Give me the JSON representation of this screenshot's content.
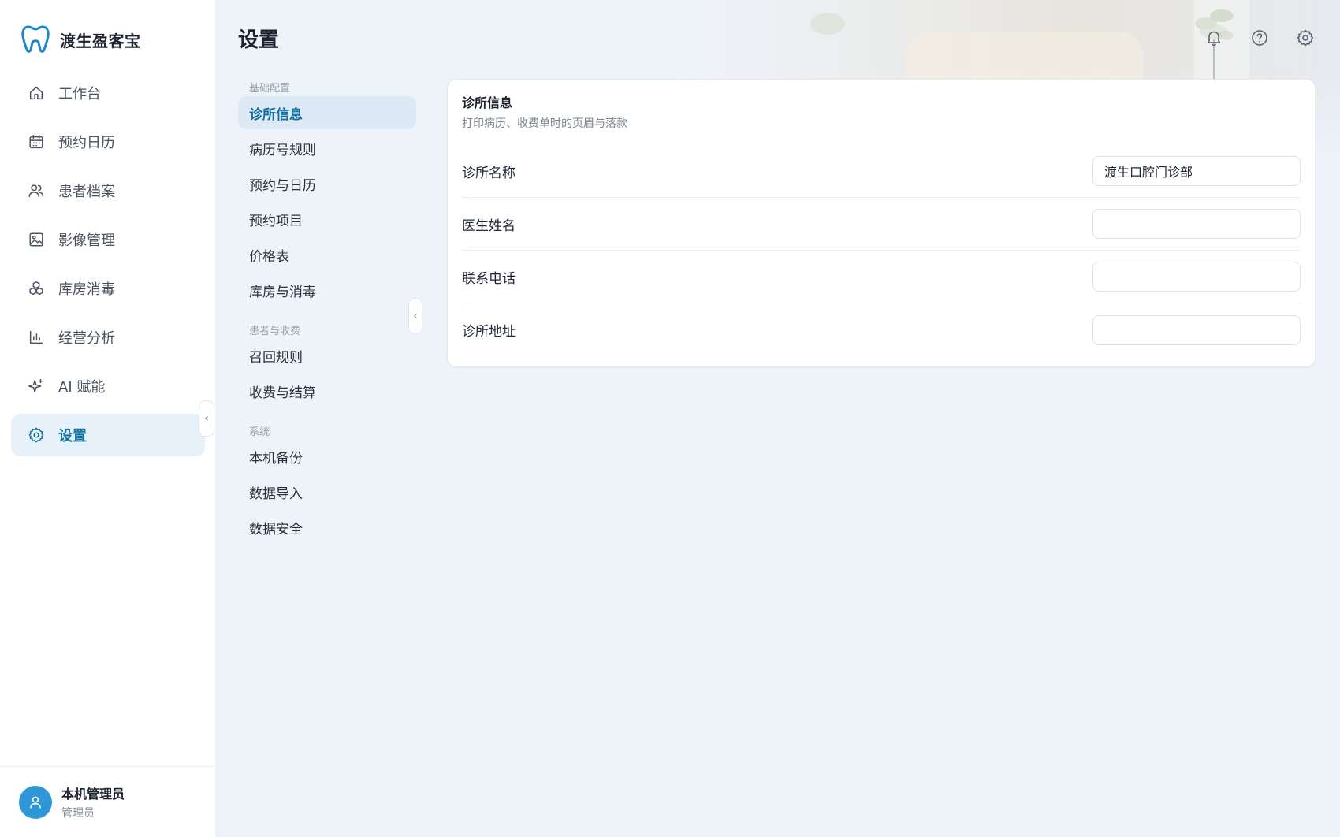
{
  "brand": {
    "name": "渡生盈客宝",
    "accent": "#1e88c8"
  },
  "sidebar": {
    "items": [
      {
        "label": "工作台",
        "icon": "home-icon",
        "active": false
      },
      {
        "label": "预约日历",
        "icon": "calendar-icon",
        "active": false
      },
      {
        "label": "患者档案",
        "icon": "users-icon",
        "active": false
      },
      {
        "label": "影像管理",
        "icon": "image-icon",
        "active": false
      },
      {
        "label": "库房消毒",
        "icon": "boxes-icon",
        "active": false
      },
      {
        "label": "经营分析",
        "icon": "bar-chart-icon",
        "active": false
      },
      {
        "label": "AI 赋能",
        "icon": "sparkle-icon",
        "active": false
      },
      {
        "label": "设置",
        "icon": "gear-icon",
        "active": true
      }
    ],
    "collapse_glyph": "‹"
  },
  "user": {
    "name": "本机管理员",
    "role": "管理员"
  },
  "header": {
    "title": "设置"
  },
  "subnav": {
    "groups": [
      {
        "title": "基础配置",
        "items": [
          "诊所信息",
          "病历号规则",
          "预约与日历",
          "预约项目",
          "价格表",
          "库房与消毒"
        ]
      },
      {
        "title": "患者与收费",
        "items": [
          "召回规则",
          "收费与结算"
        ]
      },
      {
        "title": "系统",
        "items": [
          "本机备份",
          "数据导入",
          "数据安全"
        ]
      }
    ],
    "active": "诊所信息",
    "collapse_glyph": "‹"
  },
  "card": {
    "title": "诊所信息",
    "subtitle": "打印病历、收费单时的页眉与落款",
    "fields": [
      {
        "label": "诊所名称",
        "value": "渡生口腔门诊部",
        "placeholder": ""
      },
      {
        "label": "医生姓名",
        "value": "",
        "placeholder": ""
      },
      {
        "label": "联系电话",
        "value": "",
        "placeholder": ""
      },
      {
        "label": "诊所地址",
        "value": "",
        "placeholder": ""
      }
    ]
  }
}
